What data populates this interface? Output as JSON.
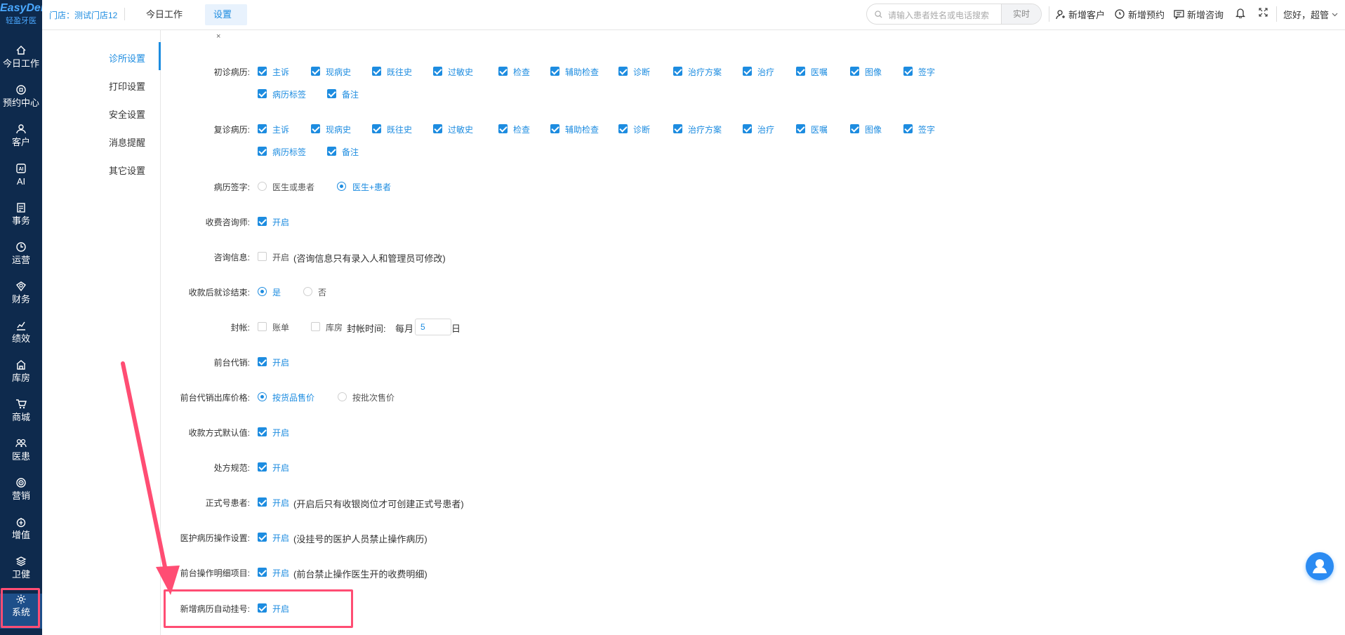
{
  "logo": {
    "brand": "EasyDent",
    "cn": "轻盈牙医"
  },
  "nav": {
    "items": [
      {
        "label": "今日工作",
        "icon": "home-icon"
      },
      {
        "label": "预约中心",
        "icon": "appointment-icon"
      },
      {
        "label": "客户",
        "icon": "customer-icon"
      },
      {
        "label": "AI",
        "icon": "ai-icon"
      },
      {
        "label": "事务",
        "icon": "task-icon"
      },
      {
        "label": "运营",
        "icon": "clock-icon"
      },
      {
        "label": "财务",
        "icon": "finance-icon"
      },
      {
        "label": "绩效",
        "icon": "chart-icon"
      },
      {
        "label": "库房",
        "icon": "warehouse-icon"
      },
      {
        "label": "商城",
        "icon": "cart-icon"
      },
      {
        "label": "医患",
        "icon": "doctor-patient-icon"
      },
      {
        "label": "营销",
        "icon": "marketing-icon"
      },
      {
        "label": "增值",
        "icon": "value-added-icon"
      },
      {
        "label": "卫健",
        "icon": "layers-icon"
      },
      {
        "label": "系统",
        "icon": "gear-icon"
      }
    ]
  },
  "header": {
    "store": "门店：测试门店12",
    "tabs": [
      {
        "label": "今日工作"
      },
      {
        "label": "设置",
        "close": "×"
      }
    ],
    "search": {
      "placeholder": "请输入患者姓名或电话搜索",
      "button": "实时"
    },
    "actions": {
      "new_customer": "新增客户",
      "new_appointment": "新增预约",
      "new_consult": "新增咨询",
      "greeting": "您好，超管"
    }
  },
  "submenu": {
    "items": [
      "诊所设置",
      "打印设置",
      "安全设置",
      "消息提醒",
      "其它设置"
    ]
  },
  "form": {
    "initial_record": {
      "label": "初诊病历:",
      "options": [
        "主诉",
        "现病史",
        "既往史",
        "过敏史",
        "检查",
        "辅助检查",
        "诊断",
        "治疗方案",
        "治疗",
        "医嘱",
        "图像",
        "签字",
        "病历标签",
        "备注"
      ]
    },
    "return_record": {
      "label": "复诊病历:",
      "options": [
        "主诉",
        "现病史",
        "既往史",
        "过敏史",
        "检查",
        "辅助检查",
        "诊断",
        "治疗方案",
        "治疗",
        "医嘱",
        "图像",
        "签字",
        "病历标签",
        "备注"
      ]
    },
    "signature": {
      "label": "病历签字:",
      "opt1": "医生或患者",
      "opt2": "医生+患者"
    },
    "fee_consultant": {
      "label": "收费咨询师:",
      "opt": "开启"
    },
    "consult_info": {
      "label": "咨询信息:",
      "opt": "开启",
      "note": "(咨询信息只有录入人和管理员可修改)"
    },
    "end_after_pay": {
      "label": "收款后就诊结束:",
      "yes": "是",
      "no": "否"
    },
    "close_account": {
      "label": "封帐:",
      "bill": "账单",
      "warehouse": "库房",
      "time_label": "封帐时间:",
      "monthly": "每月",
      "day_value": "5",
      "day_unit": "日"
    },
    "front_sale": {
      "label": "前台代销:",
      "opt": "开启"
    },
    "front_sale_price": {
      "label": "前台代销出库价格:",
      "opt1": "按货品售价",
      "opt2": "按批次售价"
    },
    "pay_default": {
      "label": "收款方式默认值:",
      "opt": "开启"
    },
    "prescription": {
      "label": "处方规范:",
      "opt": "开启"
    },
    "formal_patient": {
      "label": "正式号患者:",
      "opt": "开启",
      "note": "(开启后只有收银岗位才可创建正式号患者)"
    },
    "medical_op": {
      "label": "医护病历操作设置:",
      "opt": "开启",
      "note": "(没挂号的医护人员禁止操作病历)"
    },
    "front_detail": {
      "label": "前台操作明细项目:",
      "opt": "开启",
      "note": "(前台禁止操作医生开的收费明细)"
    },
    "auto_register": {
      "label": "新增病历自动挂号:",
      "opt": "开启"
    }
  }
}
